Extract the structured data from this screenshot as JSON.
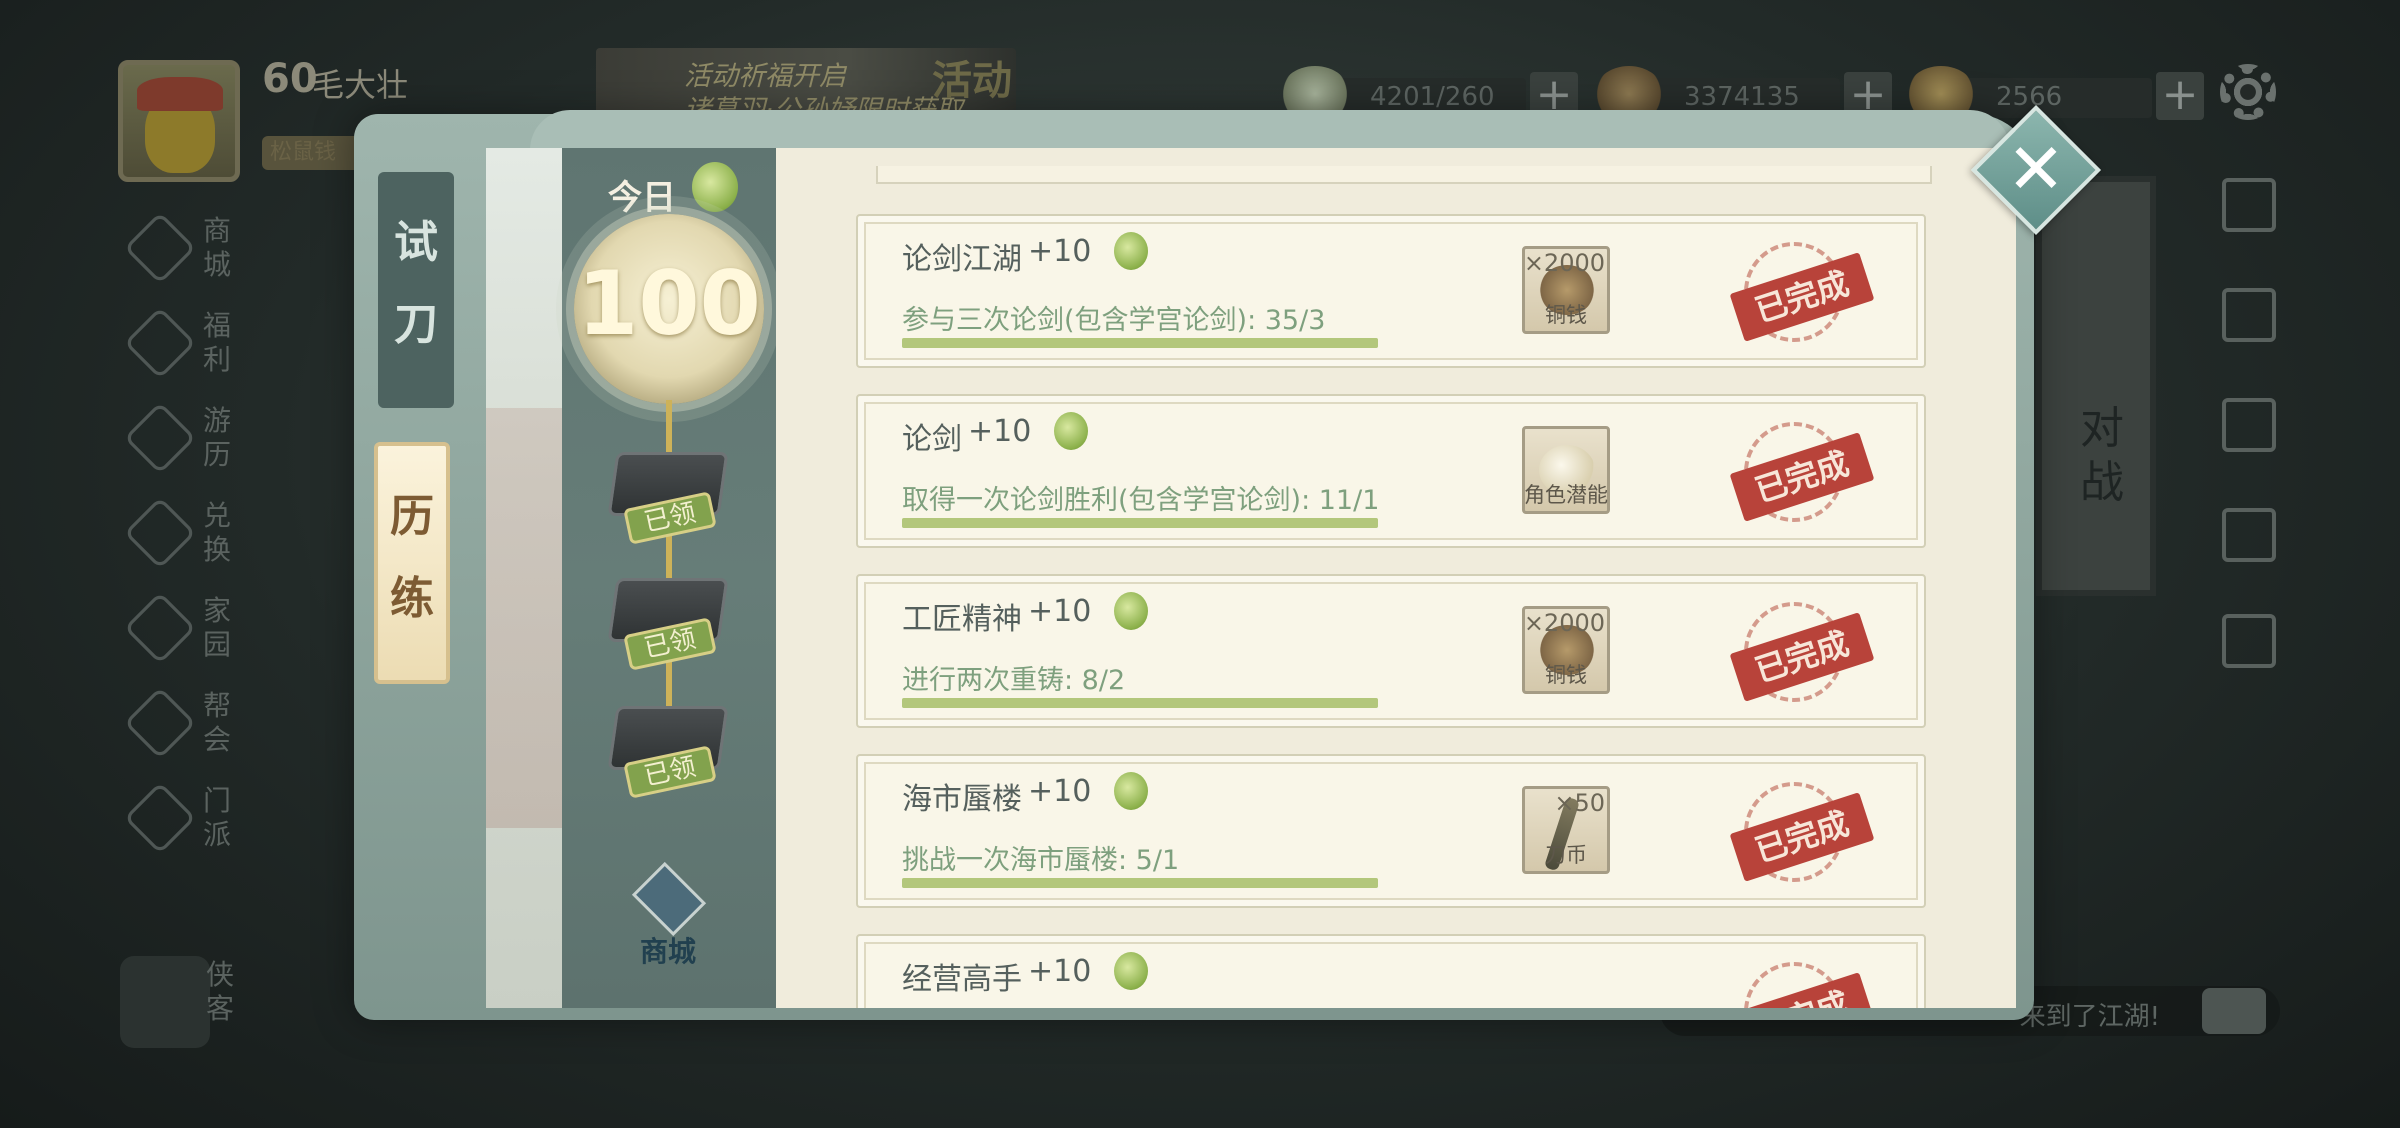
{
  "player": {
    "level": "60",
    "name": "毛大壮",
    "title": "松鼠钱"
  },
  "banner": {
    "line1": "活动祈福开启",
    "line2": "诸葛羽·公孙妤限时获取",
    "tag": "活动"
  },
  "resources": [
    {
      "icon": "rice-ball-icon",
      "value": "4201/260"
    },
    {
      "icon": "copper-coins-icon",
      "value": "3374135"
    },
    {
      "icon": "gold-ingot-icon",
      "value": "2566"
    }
  ],
  "left_menu": [
    {
      "label": "商城",
      "icon": "shop-icon"
    },
    {
      "label": "福利",
      "icon": "lotus-icon"
    },
    {
      "label": "游历",
      "icon": "horse-icon"
    },
    {
      "label": "兑换",
      "icon": "exchange-icon"
    },
    {
      "label": "家园",
      "icon": "home-icon"
    },
    {
      "label": "帮会",
      "icon": "guild-icon"
    },
    {
      "label": "门派",
      "icon": "sect-icon"
    },
    {
      "label": "侠客",
      "icon": "hero-icon"
    }
  ],
  "right_menu": [
    {
      "icon": "fist-icon"
    },
    {
      "icon": "cards-icon"
    },
    {
      "icon": "scroll-icon"
    },
    {
      "icon": "checklist-icon"
    },
    {
      "icon": "book-question-icon"
    }
  ],
  "duel_label": "对战",
  "chat": {
    "text": "来到了江湖!"
  },
  "modal": {
    "tabs": [
      {
        "label": "试刀",
        "active": false
      },
      {
        "label": "历练",
        "active": true
      }
    ],
    "today_label": "今日",
    "today_score": "100",
    "milestones": [
      {
        "status": "已领"
      },
      {
        "status": "已领"
      },
      {
        "status": "已领"
      }
    ],
    "shop_label": "商城",
    "tasks": [
      {
        "name": "论剑江湖",
        "points": "+10",
        "desc": "参与三次论剑(包含学宫论剑): 35/3",
        "progress": 1.0,
        "reward_type": "copper",
        "reward_count": "×2000",
        "reward_name": "铜钱",
        "status": "已完成"
      },
      {
        "name": "论剑",
        "points": "+10",
        "desc": "取得一次论剑胜利(包含学宫论剑): 11/1",
        "progress": 1.0,
        "reward_type": "pearl",
        "reward_count": "",
        "reward_name": "角色潜能",
        "status": "已完成"
      },
      {
        "name": "工匠精神",
        "points": "+10",
        "desc": "进行两次重铸: 8/2",
        "progress": 1.0,
        "reward_type": "copper",
        "reward_count": "×2000",
        "reward_name": "铜钱",
        "status": "已完成"
      },
      {
        "name": "海市蜃楼",
        "points": "+10",
        "desc": "挑战一次海市蜃楼: 5/1",
        "progress": 1.0,
        "reward_type": "blade",
        "reward_count": "×50",
        "reward_name": "刀币",
        "status": "已完成"
      },
      {
        "name": "经营高手",
        "points": "+10",
        "desc": "",
        "progress": 1.0,
        "reward_type": "copper",
        "reward_count": "",
        "reward_name": "",
        "status": "已完成"
      }
    ]
  },
  "colors": {
    "accent_green": "#b3c77b",
    "stamp_red": "#b8433a",
    "desc_green": "#7ea07e",
    "panel_bg": "#f0ecdc"
  }
}
